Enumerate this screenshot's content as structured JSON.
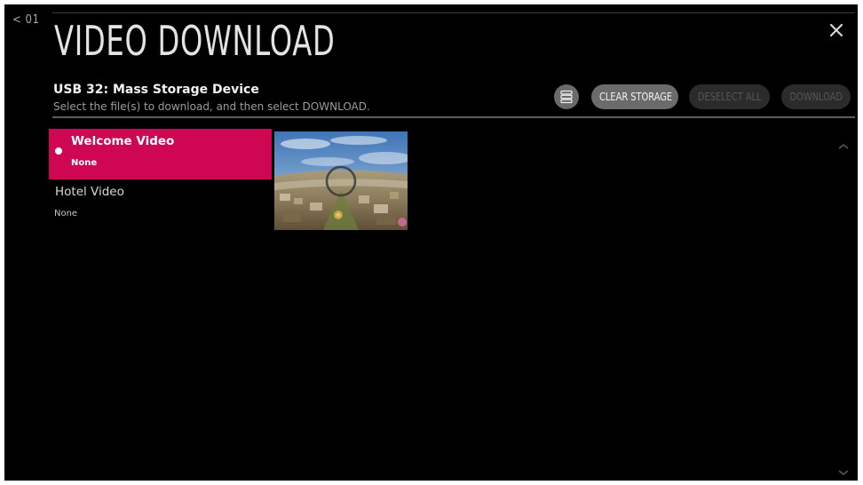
{
  "nav": {
    "back_label": "< 01"
  },
  "header": {
    "title": "VIDEO DOWNLOAD",
    "device_name": "USB 32: Mass Storage Device",
    "instruction": "Select the file(s) to download, and then select DOWNLOAD."
  },
  "toolbar": {
    "storage_icon": "storage-icon",
    "clear_storage_label": "CLEAR STORAGE",
    "deselect_all_label": "DESELECT ALL",
    "download_label": "DOWNLOAD"
  },
  "videos": [
    {
      "title": "Welcome Video",
      "status": "None",
      "selected": true
    },
    {
      "title": "Hotel Video",
      "status": "None",
      "selected": false
    }
  ],
  "preview": {
    "description_icon": "loading-spinner-icon"
  },
  "colors": {
    "accent": "#cf0652",
    "background": "#000000",
    "pill_active": "#6b6b6b",
    "pill_disabled": "#2b2b2b"
  }
}
